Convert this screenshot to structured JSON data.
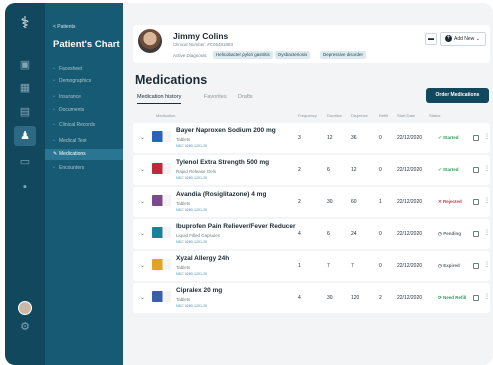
{
  "sidebar": {
    "back_label": "< Patients",
    "title": "Patient's Chart",
    "items": [
      {
        "label": "Facesheet",
        "icon": "facesheet-icon"
      },
      {
        "label": "Demographics",
        "icon": "demographics-icon"
      },
      {
        "label": "Insurance",
        "icon": "insurance-icon"
      },
      {
        "label": "Documents",
        "icon": "documents-icon"
      },
      {
        "label": "Clinical Records",
        "icon": "clinical-records-icon"
      },
      {
        "label": "Medical Test",
        "icon": "medical-test-icon"
      },
      {
        "label": "Medications",
        "icon": "medications-icon",
        "active": true
      },
      {
        "label": "Encounters",
        "icon": "encounters-icon"
      }
    ]
  },
  "patient": {
    "name": "Jimmy Colins",
    "clinical_number": "Clinical Number: #C05481883",
    "diagnosis_label": "Active Diagnosis:",
    "diagnoses": [
      "Helicobacter pylori gastritis",
      "Dysbacteriosis",
      "Depressive disorder"
    ],
    "add_new_label": "Add New"
  },
  "page": {
    "title": "Medications",
    "tabs": [
      "Medication history",
      "Favorites",
      "Drafts"
    ],
    "order_button": "Order Medications"
  },
  "table": {
    "headers": [
      "Medication",
      "Frequency",
      "Duration",
      "Dispense",
      "Refill",
      "Start Date",
      "Status"
    ],
    "rows": [
      {
        "name": "Bayer Naproxen Sodium 200 mg",
        "form": "Tablets",
        "ndc": "NDC 0280-1201-20",
        "frequency": "3",
        "duration": "12",
        "dispense": "36",
        "refill": "0",
        "start": "22/12/2020",
        "status": "Started",
        "status_color": "#2e9e5b",
        "pkg_color": "#2a64b4"
      },
      {
        "name": "Tylenol Extra Strength 500 mg",
        "form": "Rapid Release Gels",
        "ndc": "NDC 0280-1201-20",
        "frequency": "2",
        "duration": "6",
        "dispense": "12",
        "refill": "0",
        "start": "22/12/2020",
        "status": "Started",
        "status_color": "#2e9e5b",
        "pkg_color": "#c2263a"
      },
      {
        "name": "Avandia (Rosiglitazone) 4 mg",
        "form": "Tablets",
        "ndc": "NDC 0280-1201-20",
        "frequency": "2",
        "duration": "30",
        "dispense": "60",
        "refill": "1",
        "start": "22/12/2020",
        "status": "Rejected",
        "status_color": "#d0363f",
        "pkg_color": "#7b4a8e"
      },
      {
        "name": "Ibuprofen Pain Reliever/Fever Reducer",
        "form": "Liquid Filled Capsules",
        "ndc": "NDC 0280-1201-20",
        "frequency": "4",
        "duration": "6",
        "dispense": "24",
        "refill": "0",
        "start": "22/12/2020",
        "status": "Pending",
        "status_color": "#5b6b72",
        "pkg_color": "#1f7e9a"
      },
      {
        "name": "Xyzal Allergy 24h",
        "form": "Tablets",
        "ndc": "NDC 0280-1201-20",
        "frequency": "1",
        "duration": "7",
        "dispense": "7",
        "refill": "0",
        "start": "22/12/2020",
        "status": "Expired",
        "status_color": "#5b6b72",
        "pkg_color": "#e0a420"
      },
      {
        "name": "Cipralex 20 mg",
        "form": "Tablets",
        "ndc": "NDC 0280-1201-20",
        "frequency": "4",
        "duration": "30",
        "dispense": "120",
        "refill": "2",
        "start": "22/12/2020",
        "status": "Need Refill",
        "status_color": "#2e9e5b",
        "pkg_color": "#3a5fa8"
      }
    ]
  }
}
